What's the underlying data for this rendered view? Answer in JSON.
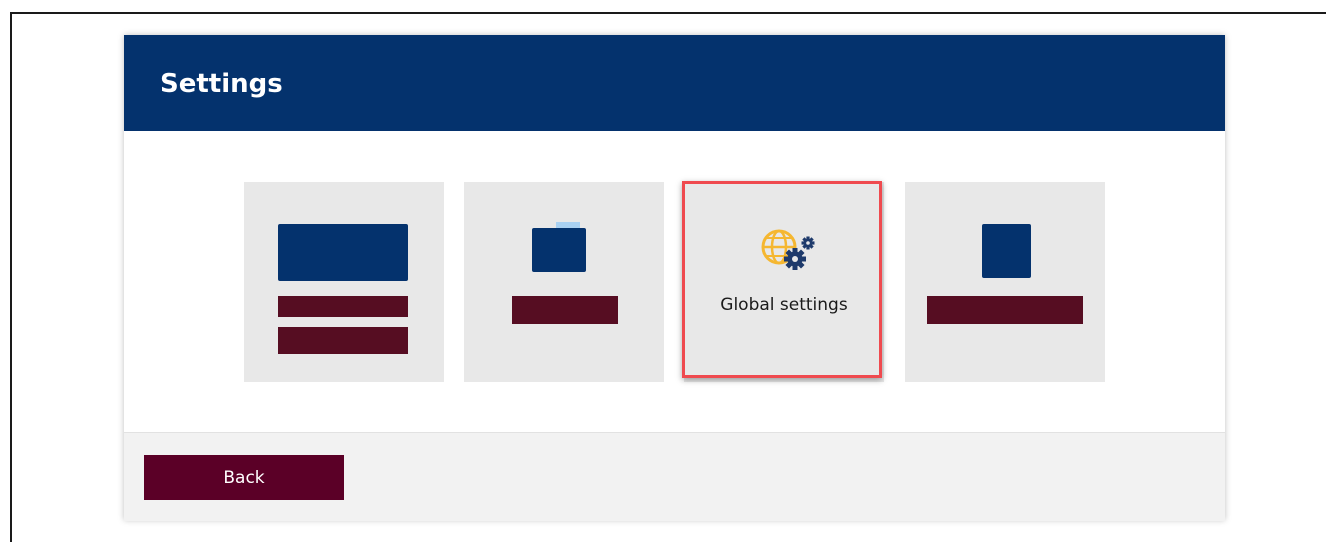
{
  "dialog": {
    "title": "Settings"
  },
  "tiles": [
    {
      "icon": "stacked-layout-icon",
      "label": ""
    },
    {
      "icon": "overlapping-cards-icon",
      "label": ""
    },
    {
      "icon": "globe-gear-icon",
      "label": "Global settings",
      "highlighted": true
    },
    {
      "icon": "block-with-bar-icon",
      "label": ""
    }
  ],
  "footer": {
    "back_label": "Back"
  },
  "colors": {
    "header": "#04326d",
    "tile_background": "#e8e8e8",
    "placeholder_blue": "#04326d",
    "placeholder_maroon": "#560d22",
    "back_button": "#5b0027",
    "highlight_border": "#ef4a4f",
    "globe": "#f5b731"
  }
}
